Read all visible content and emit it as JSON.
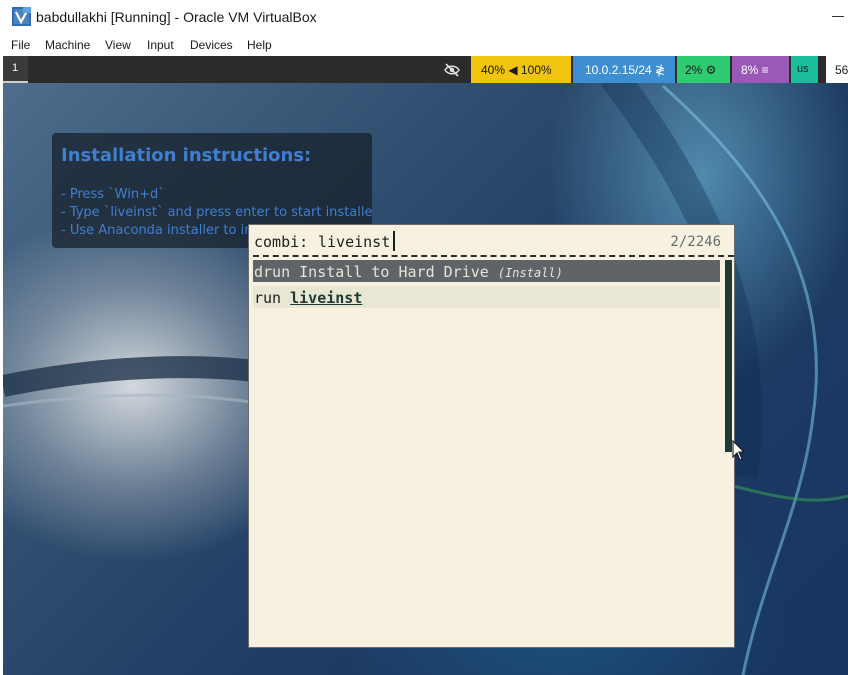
{
  "window": {
    "title": "babdullakhi [Running] - Oracle VM VirtualBox",
    "app_icon": "virtualbox-icon",
    "menu": [
      "File",
      "Machine",
      "View",
      "Input",
      "Devices",
      "Help"
    ]
  },
  "topbar": {
    "workspace": "1",
    "modules": {
      "privacy_icon": "eye-slash-icon",
      "volume": "40% ◀ 100%",
      "network": "10.0.2.15/24 ≹",
      "cpu": "2% ⚙",
      "memory": "8% ≡",
      "keyboard": "us",
      "clock": "56"
    },
    "colors": {
      "volume": "#f1c40f",
      "network": "#3e8fd1",
      "cpu": "#2ecc71",
      "memory": "#9b59b6",
      "keyboard": "#1abc9c"
    }
  },
  "instructions": {
    "title": "Installation instructions:",
    "lines": [
      "- Press `Win+d`",
      "- Type `liveinst` and press enter to start installer",
      "- Use Anaconda installer to install"
    ]
  },
  "launcher": {
    "prompt": "combi:",
    "query": "liveinst",
    "count": "2/2246",
    "results": [
      {
        "prefix": "drun",
        "text": "Install to Hard Drive",
        "sub": "(Install)",
        "selected": true
      },
      {
        "prefix": "run",
        "text": "liveinst",
        "selected": false
      }
    ]
  }
}
